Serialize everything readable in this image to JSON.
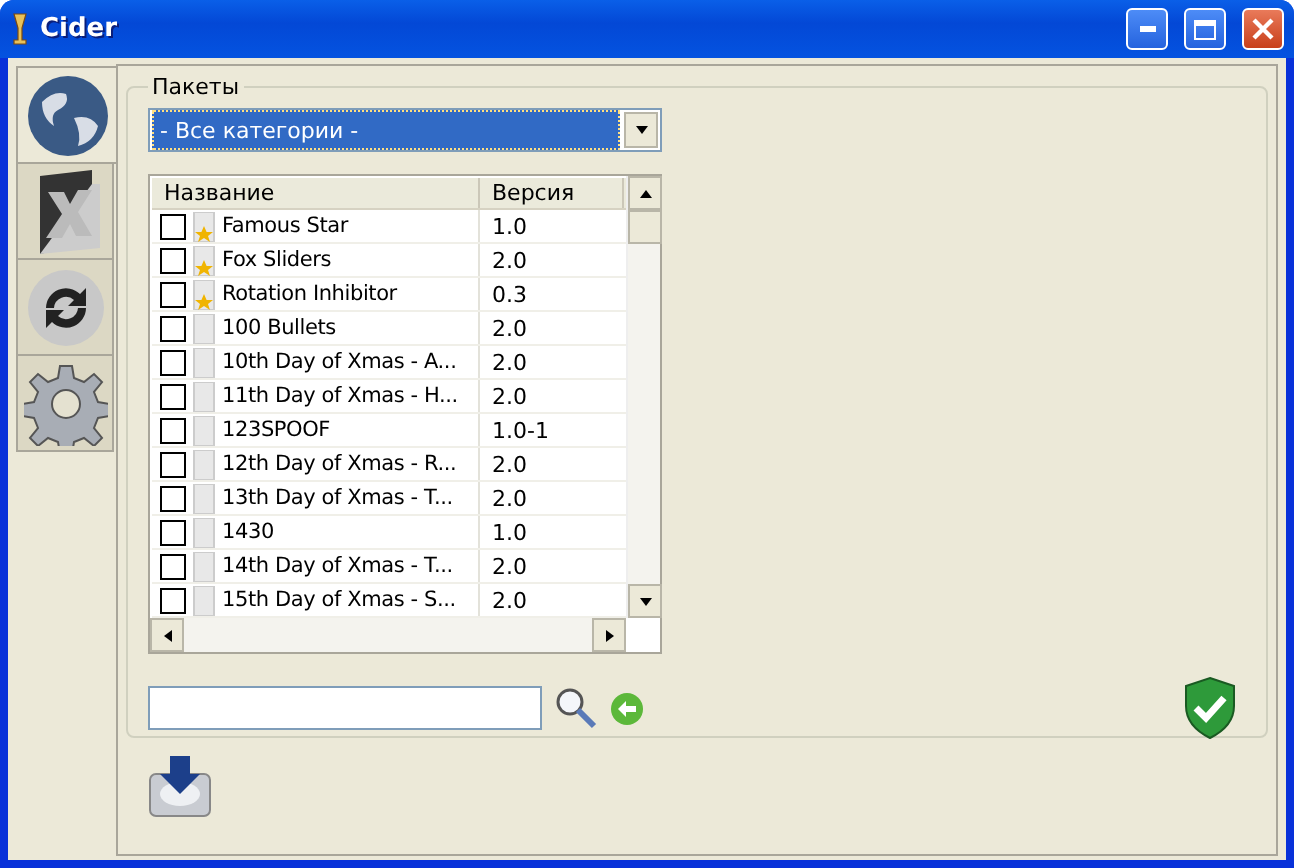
{
  "window": {
    "title": "Cider"
  },
  "sidebar": {
    "tabs": [
      {
        "kind": "globe",
        "selected": true
      },
      {
        "kind": "x",
        "selected": false
      },
      {
        "kind": "refresh",
        "selected": false
      },
      {
        "kind": "gear",
        "selected": false
      }
    ]
  },
  "packages": {
    "title": "Пакеты",
    "category": "- Все категории -",
    "columns": [
      "Название",
      "Версия"
    ],
    "rows": [
      {
        "name": "Famous Star",
        "version": "1.0",
        "checked": false,
        "starred": true
      },
      {
        "name": "Fox Sliders",
        "version": "2.0",
        "checked": false,
        "starred": true
      },
      {
        "name": "Rotation Inhibitor",
        "version": "0.3",
        "checked": false,
        "starred": true
      },
      {
        "name": "100 Bullets",
        "version": "2.0",
        "checked": false,
        "starred": false
      },
      {
        "name": "10th Day of Xmas - A...",
        "version": "2.0",
        "checked": false,
        "starred": false
      },
      {
        "name": "11th Day of Xmas - H...",
        "version": "2.0",
        "checked": false,
        "starred": false
      },
      {
        "name": "123SPOOF",
        "version": "1.0-1",
        "checked": false,
        "starred": false
      },
      {
        "name": "12th Day of Xmas - R...",
        "version": "2.0",
        "checked": false,
        "starred": false
      },
      {
        "name": "13th Day of Xmas - T...",
        "version": "2.0",
        "checked": false,
        "starred": false
      },
      {
        "name": "1430",
        "version": "1.0",
        "checked": false,
        "starred": false
      },
      {
        "name": "14th Day of Xmas - T...",
        "version": "2.0",
        "checked": false,
        "starred": false
      },
      {
        "name": "15th Day of Xmas - S...",
        "version": "2.0",
        "checked": false,
        "starred": false
      }
    ]
  }
}
